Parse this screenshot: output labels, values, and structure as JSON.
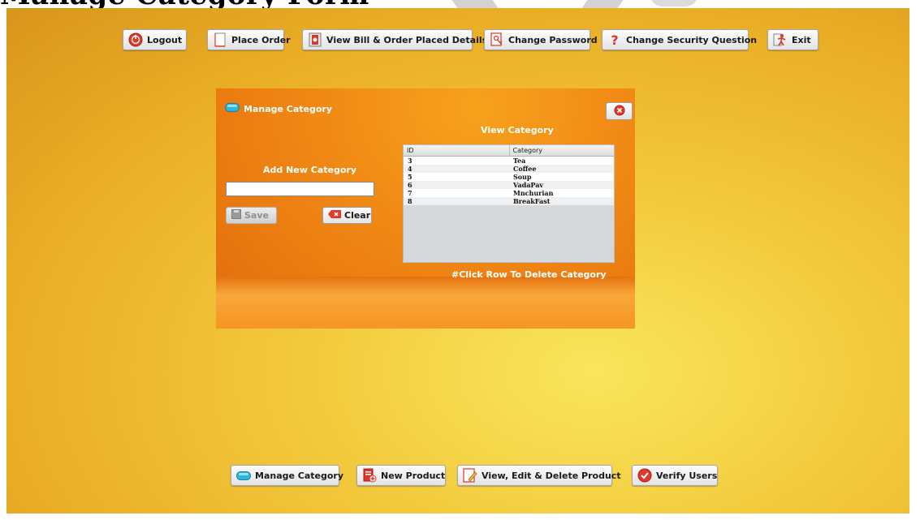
{
  "document": {
    "heading": "Manage Category Form"
  },
  "toolbar": {
    "logout": "Logout",
    "place_order": "Place Order",
    "view_bill": "View Bill & Order Placed Details",
    "change_password": "Change Password",
    "change_security_question": "Change Security Question",
    "exit": "Exit"
  },
  "dialog": {
    "title": "Manage Category",
    "add_label": "Add New Category",
    "input_value": "",
    "save_label": "Save",
    "clear_label": "Clear",
    "view_label": "View Category",
    "hint": "#Click Row To Delete Category",
    "table": {
      "columns": [
        "ID",
        "Category"
      ],
      "rows": [
        [
          "3",
          "Tea"
        ],
        [
          "4",
          "Coffee"
        ],
        [
          "5",
          "Soup"
        ],
        [
          "6",
          "VadaPav"
        ],
        [
          "7",
          "Mnchurian"
        ],
        [
          "8",
          "BreakFast"
        ]
      ]
    }
  },
  "bottom_bar": {
    "manage_category": "Manage Category",
    "new_product": "New Product",
    "view_edit_delete": "View, Edit & Delete Product",
    "verify_users": "Verify Users"
  },
  "colors": {
    "background": "#f3c93c",
    "panel": "#f28d16",
    "logout_icon": "#e23a2a",
    "exit_icon": "#d9362b",
    "verify_icon": "#e23a2a",
    "manage_icon": "#2fb7d8"
  },
  "icons": {
    "logout": "power-red-icon",
    "place_order": "document-icon",
    "view_bill": "bill-icon",
    "change_password": "key-document-icon",
    "change_security_question": "question-mark-icon",
    "exit": "exit-person-icon",
    "manage_category": "blue-pill-icon",
    "new_product": "new-document-icon",
    "view_edit_delete": "edit-document-icon",
    "verify_users": "checkmark-badge-icon",
    "close": "close-circle-icon",
    "save": "floppy-icon",
    "clear": "eraser-icon"
  }
}
